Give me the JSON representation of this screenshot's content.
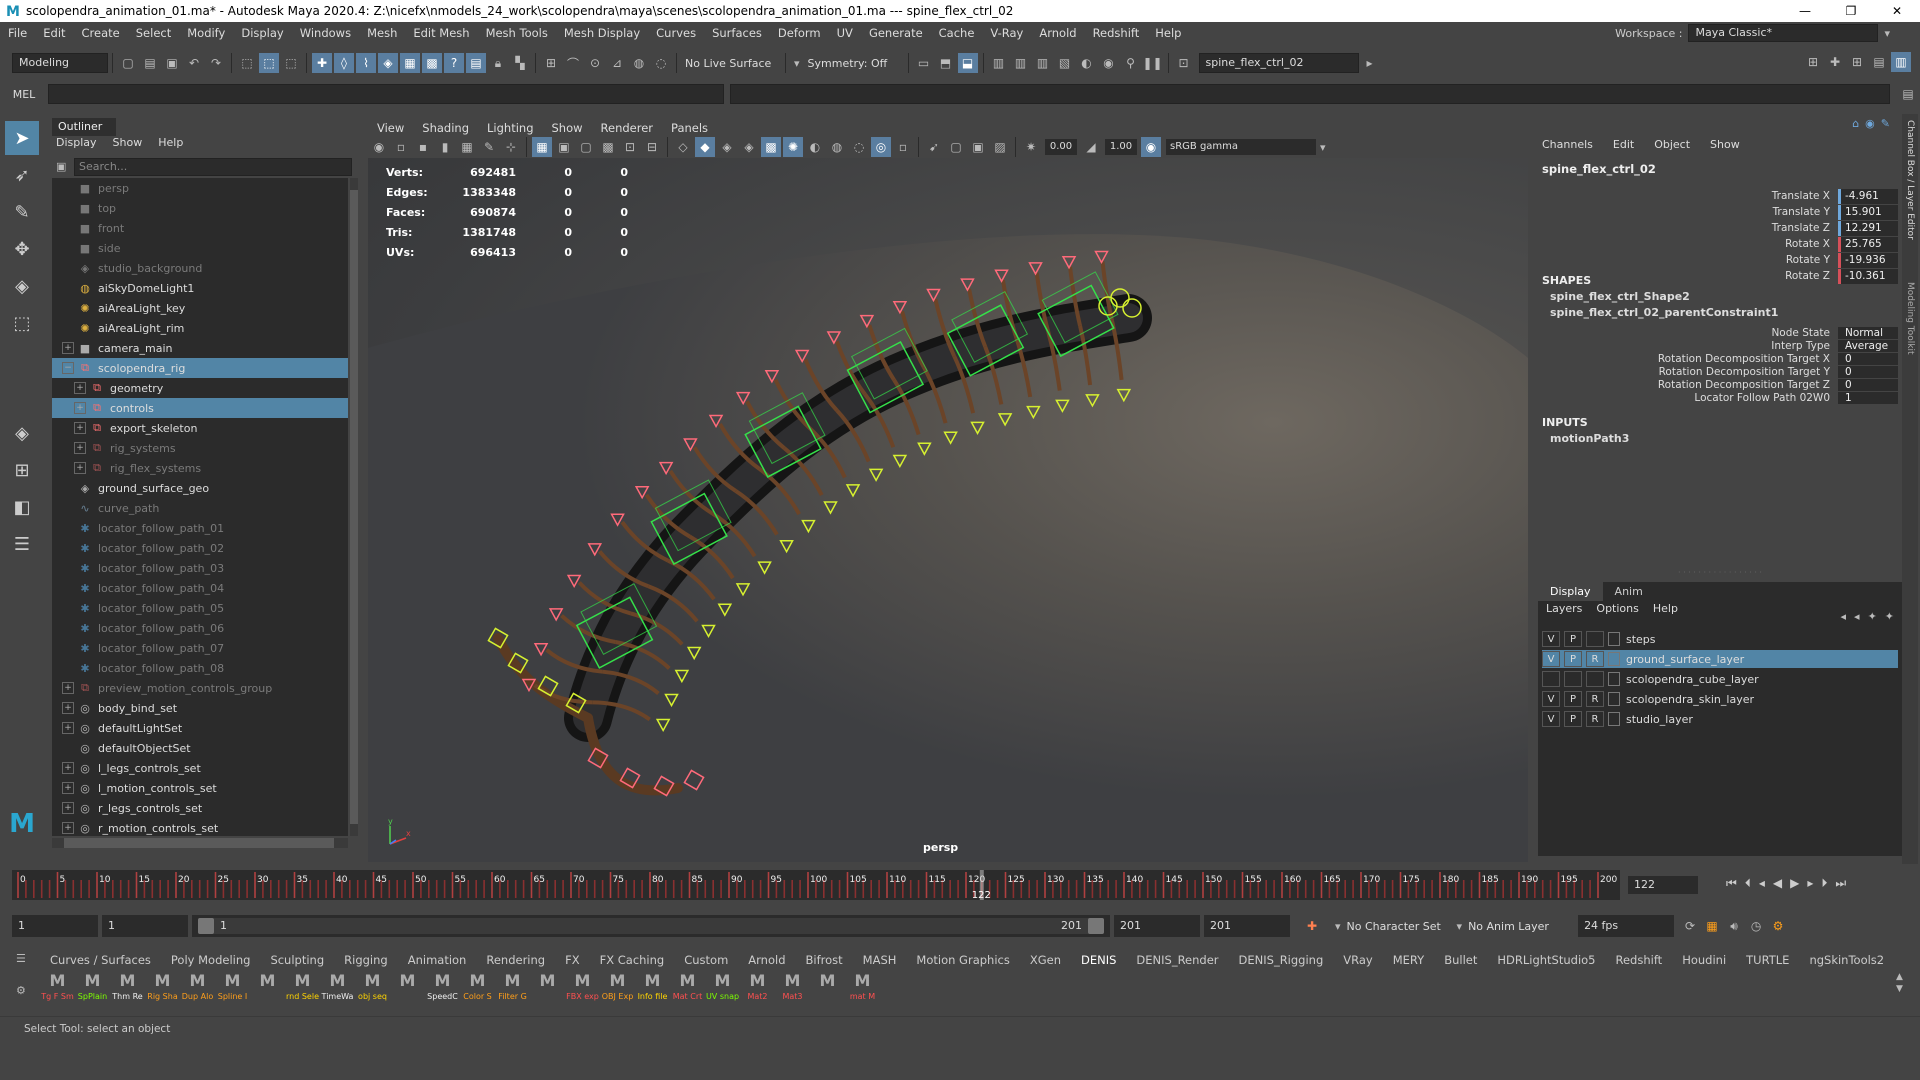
{
  "window": {
    "title": "scolopendra_animation_01.ma* - Autodesk Maya 2020.4: Z:\\nicefx\\nmodels_24_work\\scolopendra\\maya\\scenes\\scolopendra_animation_01.ma   ---   spine_flex_ctrl_02",
    "minimize": "—",
    "restore": "❐",
    "close": "✕"
  },
  "menubar": {
    "items": [
      "File",
      "Edit",
      "Create",
      "Select",
      "Modify",
      "Display",
      "Windows",
      "Mesh",
      "Edit Mesh",
      "Mesh Tools",
      "Mesh Display",
      "Curves",
      "Surfaces",
      "Deform",
      "UV",
      "Generate",
      "Cache",
      "V-Ray",
      "Arnold",
      "Redshift",
      "Help"
    ],
    "workspace_label": "Workspace :",
    "workspace_value": "Maya Classic*"
  },
  "statusline": {
    "menu_set": "Modeling",
    "live_surface": "No Live Surface",
    "symmetry": "Symmetry: Off",
    "object_name": "spine_flex_ctrl_02"
  },
  "mel": {
    "label": "MEL"
  },
  "outliner": {
    "tab": "Outliner",
    "menu": [
      "Display",
      "Show",
      "Help"
    ],
    "search_placeholder": "Search...",
    "rows": [
      {
        "label": "persp",
        "icon": "camera-icon",
        "indent": 1,
        "dim": true,
        "exp": false,
        "sel": false
      },
      {
        "label": "top",
        "icon": "camera-icon",
        "indent": 1,
        "dim": true,
        "exp": false,
        "sel": false
      },
      {
        "label": "front",
        "icon": "camera-icon",
        "indent": 1,
        "dim": true,
        "exp": false,
        "sel": false
      },
      {
        "label": "side",
        "icon": "camera-icon",
        "indent": 1,
        "dim": true,
        "exp": false,
        "sel": false
      },
      {
        "label": "studio_background",
        "icon": "mesh-icon",
        "indent": 1,
        "dim": true,
        "exp": false,
        "sel": false
      },
      {
        "label": "aiSkyDomeLight1",
        "icon": "skydome-icon",
        "indent": 1,
        "dim": false,
        "exp": false,
        "sel": false
      },
      {
        "label": "aiAreaLight_key",
        "icon": "light-icon",
        "indent": 1,
        "dim": false,
        "exp": false,
        "sel": false
      },
      {
        "label": "aiAreaLight_rim",
        "icon": "light-icon",
        "indent": 1,
        "dim": false,
        "exp": false,
        "sel": false
      },
      {
        "label": "camera_main",
        "icon": "camera-icon",
        "indent": 1,
        "dim": false,
        "exp": true,
        "sel": false
      },
      {
        "label": "scolopendra_rig",
        "icon": "group-icon",
        "indent": 1,
        "dim": false,
        "exp": true,
        "sel": true,
        "open": true
      },
      {
        "label": "geometry",
        "icon": "group-icon",
        "indent": 2,
        "dim": false,
        "exp": true,
        "sel": false
      },
      {
        "label": "controls",
        "icon": "group-icon",
        "indent": 2,
        "dim": false,
        "exp": true,
        "sel": true
      },
      {
        "label": "export_skeleton",
        "icon": "group-icon",
        "indent": 2,
        "dim": false,
        "exp": true,
        "sel": false
      },
      {
        "label": "rig_systems",
        "icon": "group-icon",
        "indent": 2,
        "dim": true,
        "exp": true,
        "sel": false
      },
      {
        "label": "rig_flex_systems",
        "icon": "group-icon",
        "indent": 2,
        "dim": true,
        "exp": true,
        "sel": false
      },
      {
        "label": "ground_surface_geo",
        "icon": "mesh-icon",
        "indent": 1,
        "dim": false,
        "exp": false,
        "sel": false
      },
      {
        "label": "curve_path",
        "icon": "curve-icon",
        "indent": 1,
        "dim": true,
        "exp": false,
        "sel": false
      },
      {
        "label": "locator_follow_path_01",
        "icon": "locator-icon",
        "indent": 1,
        "dim": true,
        "exp": false,
        "sel": false
      },
      {
        "label": "locator_follow_path_02",
        "icon": "locator-icon",
        "indent": 1,
        "dim": true,
        "exp": false,
        "sel": false
      },
      {
        "label": "locator_follow_path_03",
        "icon": "locator-icon",
        "indent": 1,
        "dim": true,
        "exp": false,
        "sel": false
      },
      {
        "label": "locator_follow_path_04",
        "icon": "locator-icon",
        "indent": 1,
        "dim": true,
        "exp": false,
        "sel": false
      },
      {
        "label": "locator_follow_path_05",
        "icon": "locator-icon",
        "indent": 1,
        "dim": true,
        "exp": false,
        "sel": false
      },
      {
        "label": "locator_follow_path_06",
        "icon": "locator-icon",
        "indent": 1,
        "dim": true,
        "exp": false,
        "sel": false
      },
      {
        "label": "locator_follow_path_07",
        "icon": "locator-icon",
        "indent": 1,
        "dim": true,
        "exp": false,
        "sel": false
      },
      {
        "label": "locator_follow_path_08",
        "icon": "locator-icon",
        "indent": 1,
        "dim": true,
        "exp": false,
        "sel": false
      },
      {
        "label": "preview_motion_controls_group",
        "icon": "group-icon",
        "indent": 1,
        "dim": true,
        "exp": true,
        "sel": false
      },
      {
        "label": "body_bind_set",
        "icon": "set-icon",
        "indent": 1,
        "dim": false,
        "exp": true,
        "sel": false
      },
      {
        "label": "defaultLightSet",
        "icon": "set-icon",
        "indent": 1,
        "dim": false,
        "exp": true,
        "sel": false
      },
      {
        "label": "defaultObjectSet",
        "icon": "set-icon",
        "indent": 1,
        "dim": false,
        "exp": false,
        "sel": false
      },
      {
        "label": "l_legs_controls_set",
        "icon": "set-icon",
        "indent": 1,
        "dim": false,
        "exp": true,
        "sel": false
      },
      {
        "label": "l_motion_controls_set",
        "icon": "set-icon",
        "indent": 1,
        "dim": false,
        "exp": true,
        "sel": false
      },
      {
        "label": "r_legs_controls_set",
        "icon": "set-icon",
        "indent": 1,
        "dim": false,
        "exp": true,
        "sel": false
      },
      {
        "label": "r_motion_controls_set",
        "icon": "set-icon",
        "indent": 1,
        "dim": false,
        "exp": true,
        "sel": false
      }
    ]
  },
  "viewport": {
    "menu": [
      "View",
      "Shading",
      "Lighting",
      "Show",
      "Renderer",
      "Panels"
    ],
    "exposure": "0.00",
    "gamma_value": "1.00",
    "color_space": "sRGB gamma",
    "camera_label": "persp",
    "hud": [
      {
        "label": "Verts:",
        "v": "692481",
        "a": "0",
        "b": "0"
      },
      {
        "label": "Edges:",
        "v": "1383348",
        "a": "0",
        "b": "0"
      },
      {
        "label": "Faces:",
        "v": "690874",
        "a": "0",
        "b": "0"
      },
      {
        "label": "Tris:",
        "v": "1381748",
        "a": "0",
        "b": "0"
      },
      {
        "label": "UVs:",
        "v": "696413",
        "a": "0",
        "b": "0"
      }
    ],
    "axis_y": "y",
    "axis_x": "x"
  },
  "channelbox": {
    "menu": [
      "Channels",
      "Edit",
      "Object",
      "Show"
    ],
    "node": "spine_flex_ctrl_02",
    "attrs": [
      {
        "name": "Translate X",
        "value": "-4.961",
        "kind": "t"
      },
      {
        "name": "Translate Y",
        "value": "15.901",
        "kind": "t"
      },
      {
        "name": "Translate Z",
        "value": "12.291",
        "kind": "t"
      },
      {
        "name": "Rotate X",
        "value": "25.765",
        "kind": "r"
      },
      {
        "name": "Rotate Y",
        "value": "-19.936",
        "kind": "r"
      },
      {
        "name": "Rotate Z",
        "value": "-10.361",
        "kind": "r"
      }
    ],
    "shapes_header": "SHAPES",
    "shapes": [
      "spine_flex_ctrl_Shape2",
      "spine_flex_ctrl_02_parentConstraint1"
    ],
    "constraint_attrs": [
      {
        "name": "Node State",
        "value": "Normal"
      },
      {
        "name": "Interp Type",
        "value": "Average"
      },
      {
        "name": "Rotation Decomposition Target X",
        "value": "0"
      },
      {
        "name": "Rotation Decomposition Target Y",
        "value": "0"
      },
      {
        "name": "Rotation Decomposition Target Z",
        "value": "0"
      },
      {
        "name": "Locator Follow Path 02W0",
        "value": "1"
      }
    ],
    "inputs_header": "INPUTS",
    "inputs": [
      "motionPath3"
    ],
    "side_tab_1": "Channel Box / Layer Editor",
    "side_tab_2": "Modeling Toolkit"
  },
  "layers": {
    "tabs": [
      "Display",
      "Anim"
    ],
    "menu": [
      "Layers",
      "Options",
      "Help"
    ],
    "rows": [
      {
        "v": "V",
        "p": "P",
        "r": "",
        "name": "steps",
        "sel": false
      },
      {
        "v": "V",
        "p": "P",
        "r": "R",
        "name": "ground_surface_layer",
        "sel": true
      },
      {
        "v": "",
        "p": "",
        "r": "",
        "name": "scolopendra_cube_layer",
        "sel": false
      },
      {
        "v": "V",
        "p": "P",
        "r": "R",
        "name": "scolopendra_skin_layer",
        "sel": false
      },
      {
        "v": "V",
        "p": "P",
        "r": "R",
        "name": "studio_layer",
        "sel": false
      }
    ]
  },
  "timeline": {
    "ticks": [
      "0",
      "5",
      "10",
      "15",
      "20",
      "25",
      "30",
      "35",
      "40",
      "45",
      "50",
      "55",
      "60",
      "65",
      "70",
      "75",
      "80",
      "85",
      "90",
      "95",
      "100",
      "105",
      "110",
      "115",
      "120",
      "125",
      "130",
      "135",
      "140",
      "145",
      "150",
      "155",
      "160",
      "165",
      "170",
      "175",
      "180",
      "185",
      "190",
      "195",
      "200"
    ],
    "start": 0,
    "end": 200,
    "current": 122,
    "current_label": "122",
    "current_field": "122"
  },
  "range": {
    "start": "1",
    "playback_start": "1",
    "slider_left": "1",
    "slider_right": "201",
    "playback_end": "201",
    "end": "201",
    "character_set": "No Character Set",
    "anim_layer": "No Anim Layer",
    "fps": "24 fps"
  },
  "shelf": {
    "tabs": [
      "Curves / Surfaces",
      "Poly Modeling",
      "Sculpting",
      "Rigging",
      "Animation",
      "Rendering",
      "FX",
      "FX Caching",
      "Custom",
      "Arnold",
      "Bifrost",
      "MASH",
      "Motion Graphics",
      "XGen",
      "DENIS",
      "DENIS_Render",
      "DENIS_Rigging",
      "VRay",
      "MERY",
      "Bullet",
      "HDRLightStudio5",
      "Redshift",
      "Houdini",
      "TURTLE",
      "ngSkinTools2"
    ],
    "active_tab": "DENIS",
    "buttons": [
      {
        "label": "Tg F Sm",
        "color": "#ff5050"
      },
      {
        "label": "SpPlain",
        "color": "#7cfc00"
      },
      {
        "label": "Thm Re",
        "color": "#eeeeee"
      },
      {
        "label": "Rig Sha",
        "color": "#ff9f1a"
      },
      {
        "label": "Dup Alo",
        "color": "#ff9f1a"
      },
      {
        "label": "Spline I",
        "color": "#ff9f1a"
      },
      {
        "label": "",
        "color": "#eeeeee"
      },
      {
        "label": "rnd Sele",
        "color": "#ffd400"
      },
      {
        "label": "TimeWa",
        "color": "#eeeeee"
      },
      {
        "label": "obj seq",
        "color": "#ffd400"
      },
      {
        "label": "",
        "color": "#eeeeee"
      },
      {
        "label": "SpeedC",
        "color": "#eeeeee"
      },
      {
        "label": "Color S",
        "color": "#ff9f1a"
      },
      {
        "label": "Filter G",
        "color": "#ff9f1a"
      },
      {
        "label": "",
        "color": "#eeeeee"
      },
      {
        "label": "FBX exp",
        "color": "#ff5050"
      },
      {
        "label": "OBJ Exp",
        "color": "#ff9f1a"
      },
      {
        "label": "Info file",
        "color": "#ffd400"
      },
      {
        "label": "Mat Crt",
        "color": "#ff5050"
      },
      {
        "label": "UV snap",
        "color": "#7cfc00"
      },
      {
        "label": "Mat2",
        "color": "#ff5050"
      },
      {
        "label": "Mat3",
        "color": "#ff5050"
      },
      {
        "label": "",
        "color": "#eeeeee"
      },
      {
        "label": "mat M",
        "color": "#ff5050"
      }
    ]
  },
  "helpline": {
    "text": "Select Tool: select an object"
  },
  "colors": {
    "accent": "#5285a6",
    "ctrl_green": "#35e04a",
    "ctrl_yellow": "#d6f030",
    "ctrl_red": "#ff6a7a"
  }
}
